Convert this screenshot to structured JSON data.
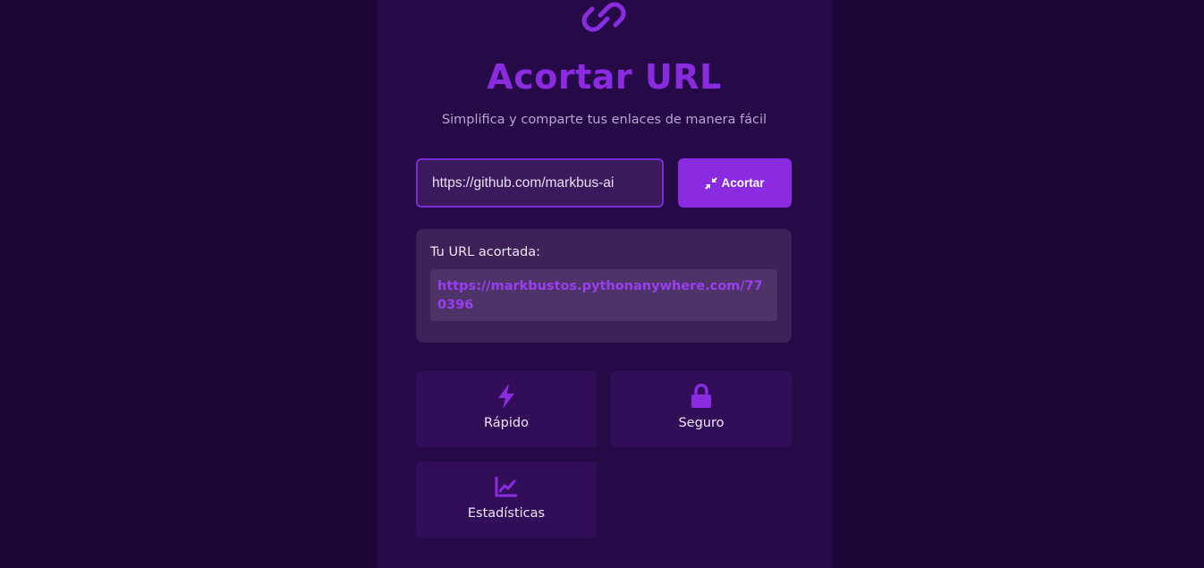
{
  "app": {
    "logo_icon": "link-icon",
    "title": "Acortar URL",
    "subtitle": "Simplifica y comparte tus enlaces de manera fácil"
  },
  "form": {
    "url_value": "https://github.com/markbus-ai",
    "shorten_icon": "compress-icon",
    "shorten_label": "Acortar"
  },
  "result": {
    "label": "Tu URL acortada:",
    "short_url": "https://markbustos.pythonanywhere.com/770396"
  },
  "features": [
    {
      "icon": "bolt-icon",
      "label": "Rápido"
    },
    {
      "icon": "lock-icon",
      "label": "Seguro"
    },
    {
      "icon": "chart-line-icon",
      "label": "Estadísticas"
    }
  ],
  "colors": {
    "background": "#1a0536",
    "card": "#260a48",
    "accent": "#8a2be2",
    "result_panel": "#3d2158",
    "feature_card": "#320d58"
  }
}
